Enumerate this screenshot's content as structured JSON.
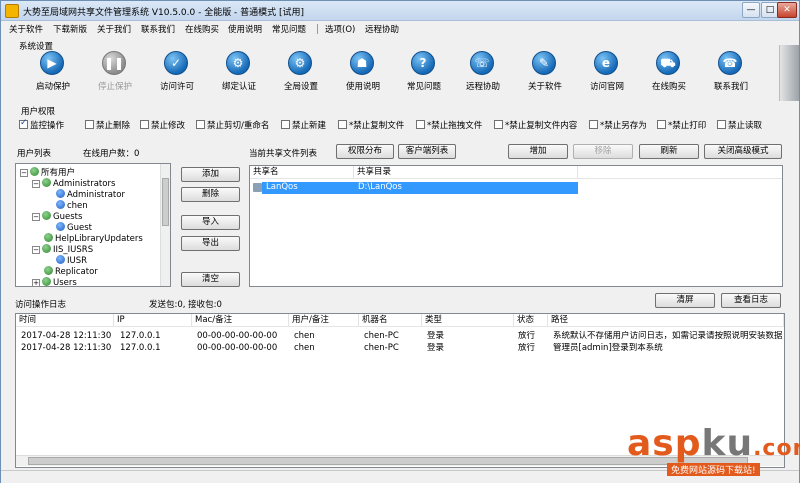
{
  "window": {
    "title": "大势至局域网共享文件管理系统 V10.5.0.0 - 全能版 - 普通模式 [试用]",
    "minimize": "—",
    "maximize": "□",
    "close": "✕"
  },
  "menu": [
    "关于软件",
    "下载新版",
    "关于我们",
    "联系我们",
    "在线购买",
    "使用说明",
    "常见问题",
    "选项(O)",
    "远程协助"
  ],
  "system_settings": {
    "label": "系统设置",
    "tools": [
      {
        "label": "启动保护",
        "icon": "play-icon",
        "glyph": "▶",
        "enabled": true
      },
      {
        "label": "停止保护",
        "icon": "pause-icon",
        "glyph": "❚❚",
        "enabled": false
      },
      {
        "label": "访问许可",
        "icon": "permission-icon",
        "glyph": "✓",
        "enabled": true
      },
      {
        "label": "绑定认证",
        "icon": "bind-icon",
        "glyph": "⚙",
        "enabled": true
      },
      {
        "label": "全局设置",
        "icon": "settings-icon",
        "glyph": "⚙",
        "enabled": true
      },
      {
        "label": "使用说明",
        "icon": "manual-icon",
        "glyph": "☗",
        "enabled": true
      },
      {
        "label": "常见问题",
        "icon": "faq-icon",
        "glyph": "?",
        "enabled": true
      },
      {
        "label": "远程协助",
        "icon": "remote-icon",
        "glyph": "☏",
        "enabled": true
      },
      {
        "label": "关于软件",
        "icon": "about-icon",
        "glyph": "✎",
        "enabled": true
      },
      {
        "label": "访问官网",
        "icon": "website-icon",
        "glyph": "e",
        "enabled": true
      },
      {
        "label": "在线购买",
        "icon": "cart-icon",
        "glyph": "⛟",
        "enabled": true
      },
      {
        "label": "联系我们",
        "icon": "contact-icon",
        "glyph": "☎",
        "enabled": true
      }
    ]
  },
  "permissions": {
    "label": "用户权限",
    "items": [
      {
        "label": "监控操作",
        "checked": true
      },
      {
        "label": "禁止删除",
        "checked": false
      },
      {
        "label": "禁止修改",
        "checked": false
      },
      {
        "label": "禁止剪切/重命名",
        "checked": false
      },
      {
        "label": "禁止新建",
        "checked": false
      },
      {
        "label": "*禁止复制文件",
        "checked": false
      },
      {
        "label": "*禁止拖拽文件",
        "checked": false
      },
      {
        "label": "*禁止复制文件内容",
        "checked": false
      },
      {
        "label": "*禁止另存为",
        "checked": false
      },
      {
        "label": "*禁止打印",
        "checked": false
      },
      {
        "label": "禁止读取",
        "checked": false
      }
    ]
  },
  "user_list": {
    "label": "用户列表",
    "online_label": "在线用户数：0",
    "tree": [
      {
        "label": "所有用户",
        "type": "grp",
        "level": 0,
        "toggle": "−"
      },
      {
        "label": "Administrators",
        "type": "grp",
        "level": 1,
        "toggle": "−"
      },
      {
        "label": "Administrator",
        "type": "usr",
        "level": 2,
        "toggle": ""
      },
      {
        "label": "chen",
        "type": "usr",
        "level": 2,
        "toggle": ""
      },
      {
        "label": "Guests",
        "type": "grp",
        "level": 1,
        "toggle": "−"
      },
      {
        "label": "Guest",
        "type": "usr",
        "level": 2,
        "toggle": ""
      },
      {
        "label": "HelpLibraryUpdaters",
        "type": "grp",
        "level": 1,
        "toggle": ""
      },
      {
        "label": "IIS_IUSRS",
        "type": "grp",
        "level": 1,
        "toggle": "−"
      },
      {
        "label": "IUSR",
        "type": "usr",
        "level": 2,
        "toggle": ""
      },
      {
        "label": "Replicator",
        "type": "grp",
        "level": 1,
        "toggle": ""
      },
      {
        "label": "Users",
        "type": "grp",
        "level": 1,
        "toggle": "+"
      }
    ],
    "buttons": {
      "add": "添加",
      "delete": "删除",
      "import": "导入",
      "export": "导出",
      "clear": "清空"
    }
  },
  "shares": {
    "label": "当前共享文件列表",
    "perm_dist": "权限分布",
    "client_list": "客户端列表",
    "add": "增加",
    "remove": "移除",
    "refresh": "刷新",
    "advanced": "关闭高级模式",
    "headers": [
      "共享名",
      "共享目录"
    ],
    "rows": [
      {
        "name": "LanQos",
        "path": "D:\\LanQos"
      }
    ]
  },
  "log": {
    "label": "访问操作日志",
    "counter": "发送包:0, 接收包:0",
    "clear": "清屏",
    "view": "查看日志",
    "headers": [
      "时间",
      "IP",
      "Mac/备注",
      "用户/备注",
      "机器名",
      "类型",
      "状态",
      "路径"
    ],
    "rows": [
      [
        "2017-04-28 12:11:30",
        "127.0.0.1",
        "00-00-00-00-00-00",
        "chen",
        "chen-PC",
        "登录",
        "放行",
        "系统默认不存储用户访问日志，如需记录请按照说明安装数据库"
      ],
      [
        "2017-04-28 12:11:30",
        "127.0.0.1",
        "00-00-00-00-00-00",
        "chen",
        "chen-PC",
        "登录",
        "放行",
        "管理员[admin]登录到本系统"
      ]
    ]
  },
  "watermark": {
    "asp": "asp",
    "ku": "ku",
    "com": ".com",
    "sub": "免费网站源码下载站!"
  }
}
